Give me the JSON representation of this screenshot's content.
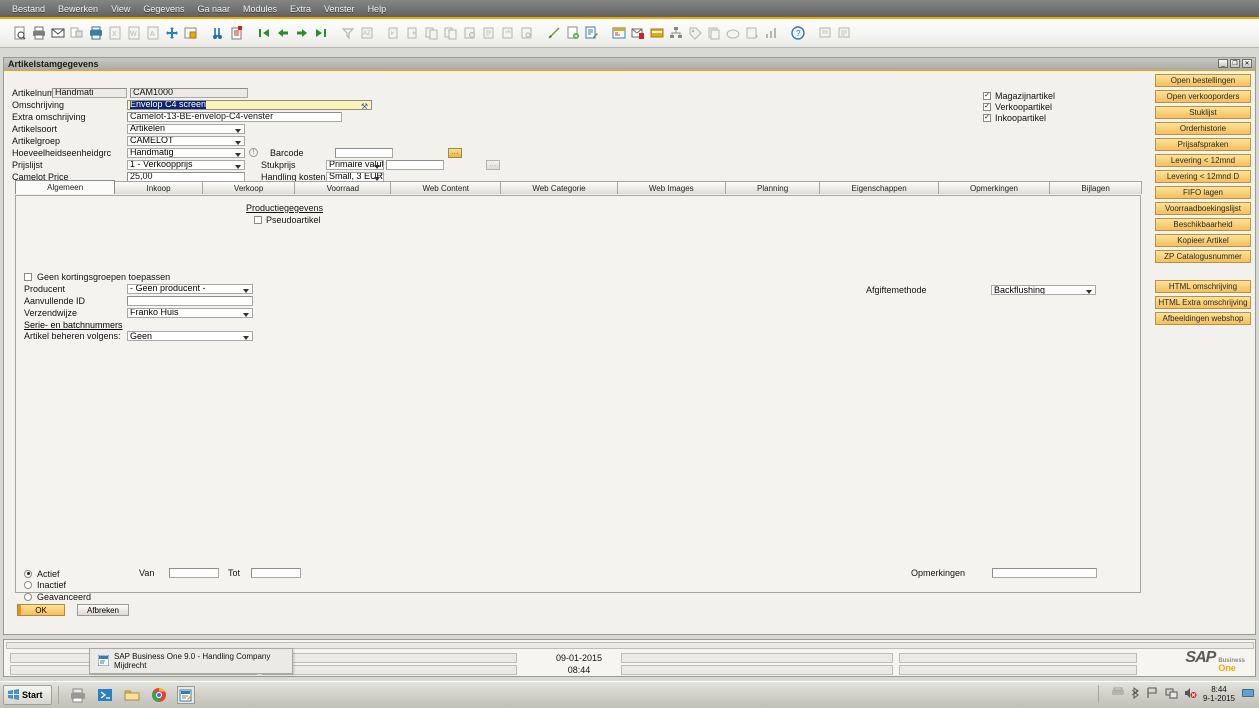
{
  "window": {
    "title": "Artikelstamgegevens",
    "minimize": "_",
    "maximize": "❐",
    "close": "✕"
  },
  "menu": {
    "items": [
      {
        "label": "Bestand"
      },
      {
        "label": "Bewerken"
      },
      {
        "label": "View"
      },
      {
        "label": "Gegevens"
      },
      {
        "label": "Ga naar"
      },
      {
        "label": "Modules"
      },
      {
        "label": "Extra"
      },
      {
        "label": "Venster"
      },
      {
        "label": "Help"
      }
    ]
  },
  "toolbar": {
    "icons": [
      "preview-icon",
      "print-icon",
      "email-icon",
      "fax-icon",
      "print-preview-icon",
      "export-excel-icon",
      "export-word-icon",
      "export-pdf-icon",
      "launch-app-icon",
      "lock-icon",
      "find-icon",
      "add-record-icon",
      "first-record-icon",
      "previous-record-icon",
      "next-record-icon",
      "last-record-icon",
      "filter-icon",
      "sort-icon",
      "copy-icon",
      "paste-icon",
      "duplicate-icon",
      "copy-rows-icon",
      "copy-from-icon",
      "copy-to-icon",
      "restore-icon",
      "query-icon",
      "draw-icon",
      "new-document-icon",
      "edit-document-icon",
      "calendar-icon",
      "messages-icon",
      "inbox-icon",
      "org-chart-icon",
      "tag-icon",
      "layers-icon",
      "cloud-icon",
      "report-icon",
      "chart-icon",
      "help-icon",
      "note-icon",
      "notes-icon"
    ]
  },
  "header": {
    "fields": [
      {
        "name": "artikelnummer",
        "label": "Artikelnummer",
        "overlay_value": "Handmati",
        "value": "CAM1000"
      },
      {
        "name": "omschrijving",
        "label": "Omschrijving",
        "value": "Envelop C4 screen"
      },
      {
        "name": "extra-omschrijving",
        "label": "Extra omschrijving",
        "value": "Camelot-13-BE-envelop-C4-venster"
      },
      {
        "name": "artikelsoort",
        "label": "Artikelsoort",
        "value": "Artikelen"
      },
      {
        "name": "artikelgroep",
        "label": "Artikelgroep",
        "value": "CAMELOT"
      },
      {
        "name": "hoeveelheidseenheidgroep",
        "label": "Hoeveelheidseenheidgrc",
        "value": "Handmatig"
      },
      {
        "name": "prijslijst",
        "label": "Prijslijst",
        "value": "1 - Verkoopprijs"
      },
      {
        "name": "camelot-price",
        "label": "Camelot Price",
        "value": "25,00"
      }
    ],
    "right_fields": [
      {
        "name": "barcode",
        "label": "Barcode",
        "value": "",
        "browse": "..."
      },
      {
        "name": "stukprijs",
        "label": "Stukprijs",
        "currency": "Primaire valuta",
        "value": "",
        "browse": "..."
      },
      {
        "name": "handling-kosten",
        "label": "Handling kosten",
        "value": "Small, 3 EUR"
      }
    ],
    "checkboxes": [
      {
        "name": "magazijnartikel",
        "label": "Magazijnartikel",
        "checked": true
      },
      {
        "name": "verkoopartikel",
        "label": "Verkoopartikel",
        "checked": true
      },
      {
        "name": "inkoopartikel",
        "label": "Inkoopartikel",
        "checked": true
      }
    ]
  },
  "side_panel": {
    "group_a": [
      "Open bestellingen",
      "Open verkooporders",
      "Stuklijst",
      "Orderhistorie",
      "Prijsafspraken",
      "Levering < 12mnd",
      "Levering < 12mnd D",
      "FIFO lagen",
      "Voorraadboekingslijst",
      "Beschikbaarheid",
      "Kopieer Artikel",
      "ZP Catalogusnummer"
    ],
    "group_b": [
      "HTML omschrijving",
      "HTML Extra omschrijving",
      "Afbeeldingen webshop"
    ]
  },
  "tabs": [
    {
      "label": "Algemeen",
      "active": true
    },
    {
      "label": "Inkoop",
      "active": false
    },
    {
      "label": "Verkoop",
      "active": false
    },
    {
      "label": "Voorraad",
      "active": false
    },
    {
      "label": "Web Content",
      "active": false
    },
    {
      "label": "Web Categorie",
      "active": false
    },
    {
      "label": "Web Images",
      "active": false
    },
    {
      "label": "Planning",
      "active": false
    },
    {
      "label": "Eigenschappen",
      "active": false
    },
    {
      "label": "Opmerkingen",
      "active": false
    },
    {
      "label": "Bijlagen",
      "active": false
    }
  ],
  "tab_content": {
    "productie_header": "Productiegegevens",
    "pseudoartikel": {
      "label": "Pseudoartikel",
      "checked": false
    },
    "afgiftemethode": {
      "label": "Afgiftemethode",
      "value": "Backflushing"
    },
    "geen_kortingsgroepen": {
      "label": "Geen kortingsgroepen toepassen",
      "checked": false
    },
    "producent": {
      "label": "Producent",
      "value": "- Geen producent -"
    },
    "aanvullende_id": {
      "label": "Aanvullende ID",
      "value": ""
    },
    "verzendwijze": {
      "label": "Verzendwijze",
      "value": "Franko Huis"
    },
    "serie_batch_header": "Serie- en batchnummers",
    "artikel_beheren": {
      "label": "Artikel beheren volgens:",
      "value": "Geen"
    },
    "status_options": [
      {
        "name": "actief",
        "label": "Actief",
        "selected": true
      },
      {
        "name": "inactief",
        "label": "Inactief",
        "selected": false
      },
      {
        "name": "geavanceerd",
        "label": "Geavanceerd",
        "selected": false
      }
    ],
    "van": {
      "label": "Van",
      "value": ""
    },
    "tot": {
      "label": "Tot",
      "value": ""
    },
    "opmerkingen": {
      "label": "Opmerkingen",
      "value": ""
    }
  },
  "buttons": {
    "ok": "OK",
    "cancel": "Afbreken"
  },
  "status_bar": {
    "date": "09-01-2015",
    "time": "08:44",
    "logo_main": "SAP",
    "logo_sub1": "Business",
    "logo_sub2": "One"
  },
  "tooltip": {
    "text": "SAP Business One 9.0 - Handling Company Mijdrecht"
  },
  "taskbar": {
    "start": "Start",
    "clock_time": "8:44",
    "clock_date": "9-1-2015",
    "quicklaunch": [
      "printer-icon",
      "powershell-icon",
      "explorer-icon",
      "chrome-icon",
      "sap-business-one-icon"
    ],
    "tray": [
      "printer-tray-icon",
      "bluetooth-icon",
      "flag-icon",
      "network-icon",
      "volume-muted-icon"
    ]
  },
  "colors": {
    "accent": "#f0a800",
    "button_yellow": "#f8d07a",
    "active_field": "#fdf3b8",
    "selection_blue": "#10246e"
  }
}
